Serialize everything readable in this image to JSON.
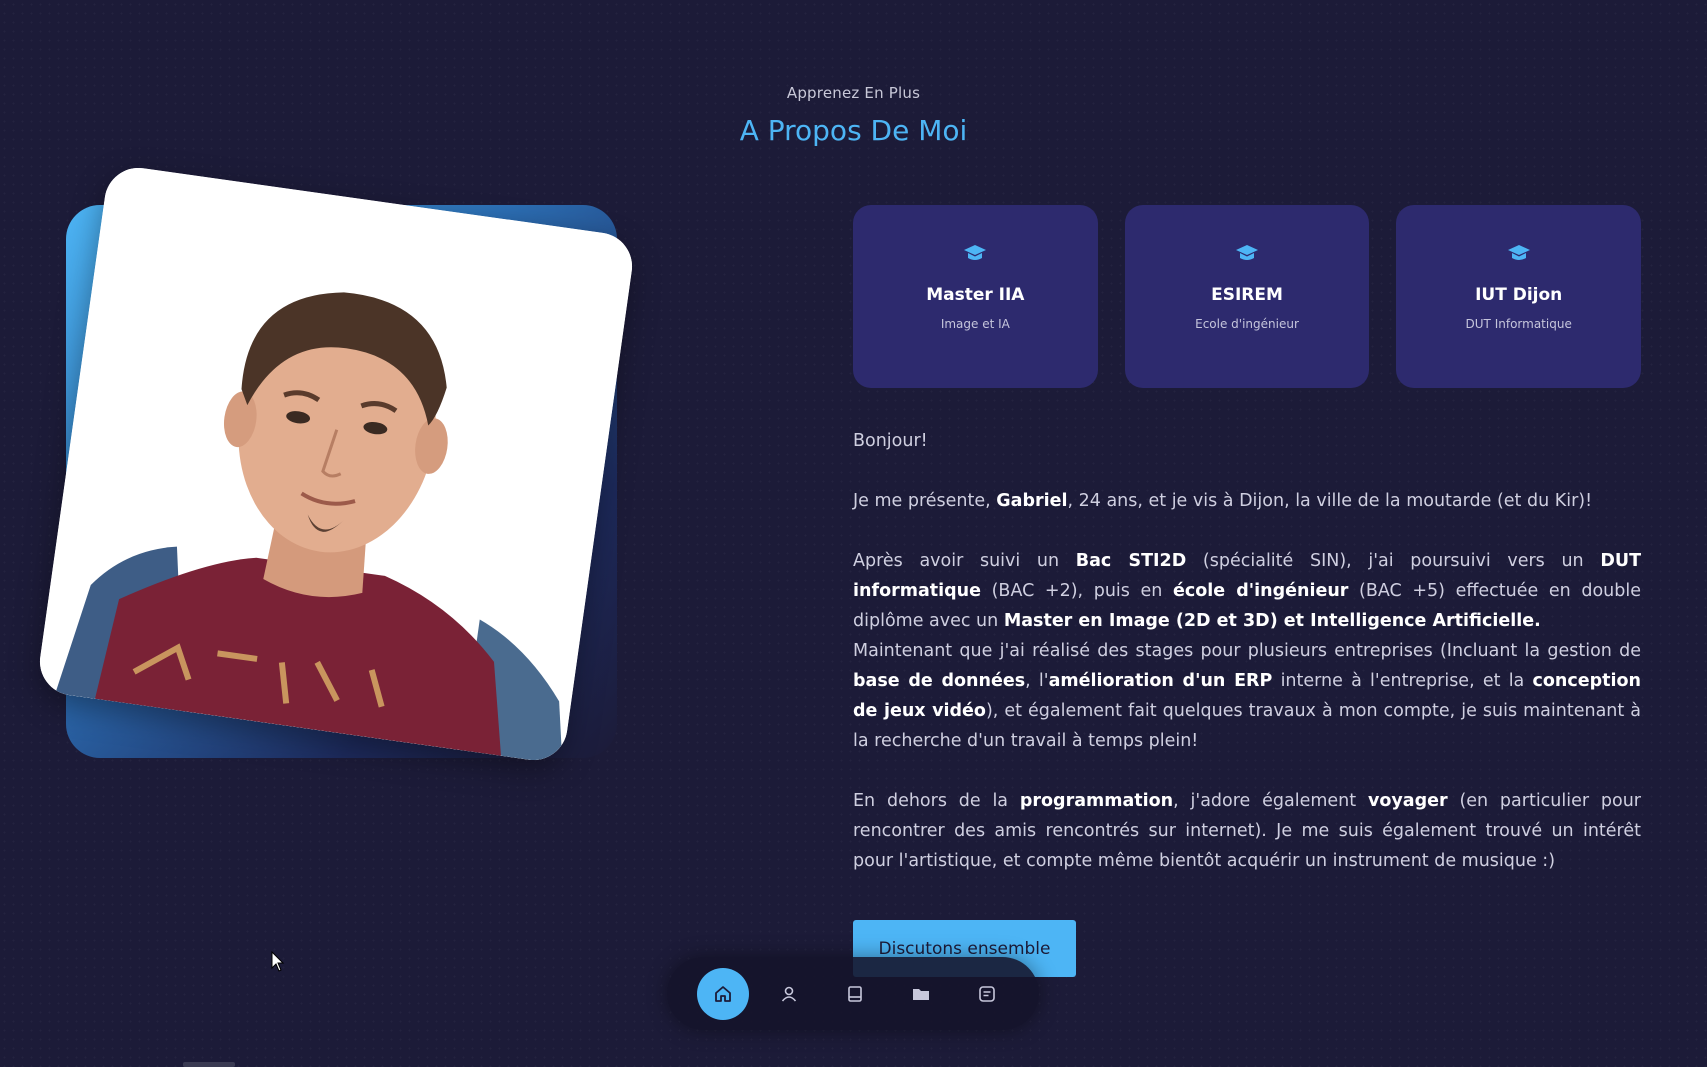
{
  "header": {
    "subtitle": "Apprenez En Plus",
    "title": "A Propos De Moi"
  },
  "photo": {
    "alt_name": "portrait-photo"
  },
  "cards": [
    {
      "icon": "graduation-cap-icon",
      "title": "Master IIA",
      "subtitle": "Image et IA"
    },
    {
      "icon": "graduation-cap-icon",
      "title": "ESIREM",
      "subtitle": "Ecole d'ingénieur"
    },
    {
      "icon": "graduation-cap-icon",
      "title": "IUT Dijon",
      "subtitle": "DUT Informatique"
    }
  ],
  "about": {
    "greeting": "Bonjour!",
    "intro": {
      "pre": "Je me présente, ",
      "name": "Gabriel",
      "post": ", 24 ans, et je vis à Dijon, la ville de la moutarde (et du Kir)!"
    },
    "education": {
      "t1": "Après avoir suivi un ",
      "b1": "Bac STI2D",
      "t2": " (spécialité SIN), j'ai poursuivi vers un ",
      "b2": "DUT informatique",
      "t3": " (BAC +2), puis en ",
      "b3": "école d'ingénieur",
      "t4": " (BAC +5) effectuée en double diplôme avec un ",
      "b4": "Master en Image (2D et 3D) et Intelligence Artificielle",
      "t5": "."
    },
    "experience": {
      "t1": "Maintenant que j'ai réalisé des stages pour plusieurs entreprises (Incluant la gestion de ",
      "b1": "base de données",
      "t2": ", l'",
      "b2": "amélioration d'un ERP",
      "t3": " interne à l'entreprise, et la ",
      "b3": "conception de jeux vidéo",
      "t4": "), et également fait quelques travaux à mon compte, je suis maintenant à la recherche d'un travail à temps plein!"
    },
    "hobbies": {
      "t1": "En dehors de la ",
      "b1": "programmation",
      "t2": ", j'adore également ",
      "b2": "voyager",
      "t3": " (en particulier pour rencontrer des amis rencontrés sur internet). Je me suis également trouvé un intérêt pour l'artistique, et compte même bientôt acquérir un instrument de musique :)"
    }
  },
  "cta_label": "Discutons ensemble",
  "nav": [
    {
      "icon": "home-icon",
      "active": true
    },
    {
      "icon": "user-icon",
      "active": false
    },
    {
      "icon": "book-icon",
      "active": false
    },
    {
      "icon": "folder-icon",
      "active": false
    },
    {
      "icon": "message-icon",
      "active": false
    }
  ],
  "colors": {
    "background": "#1c1b38",
    "accent": "#4db5f5",
    "card": "#2d2a6e"
  }
}
